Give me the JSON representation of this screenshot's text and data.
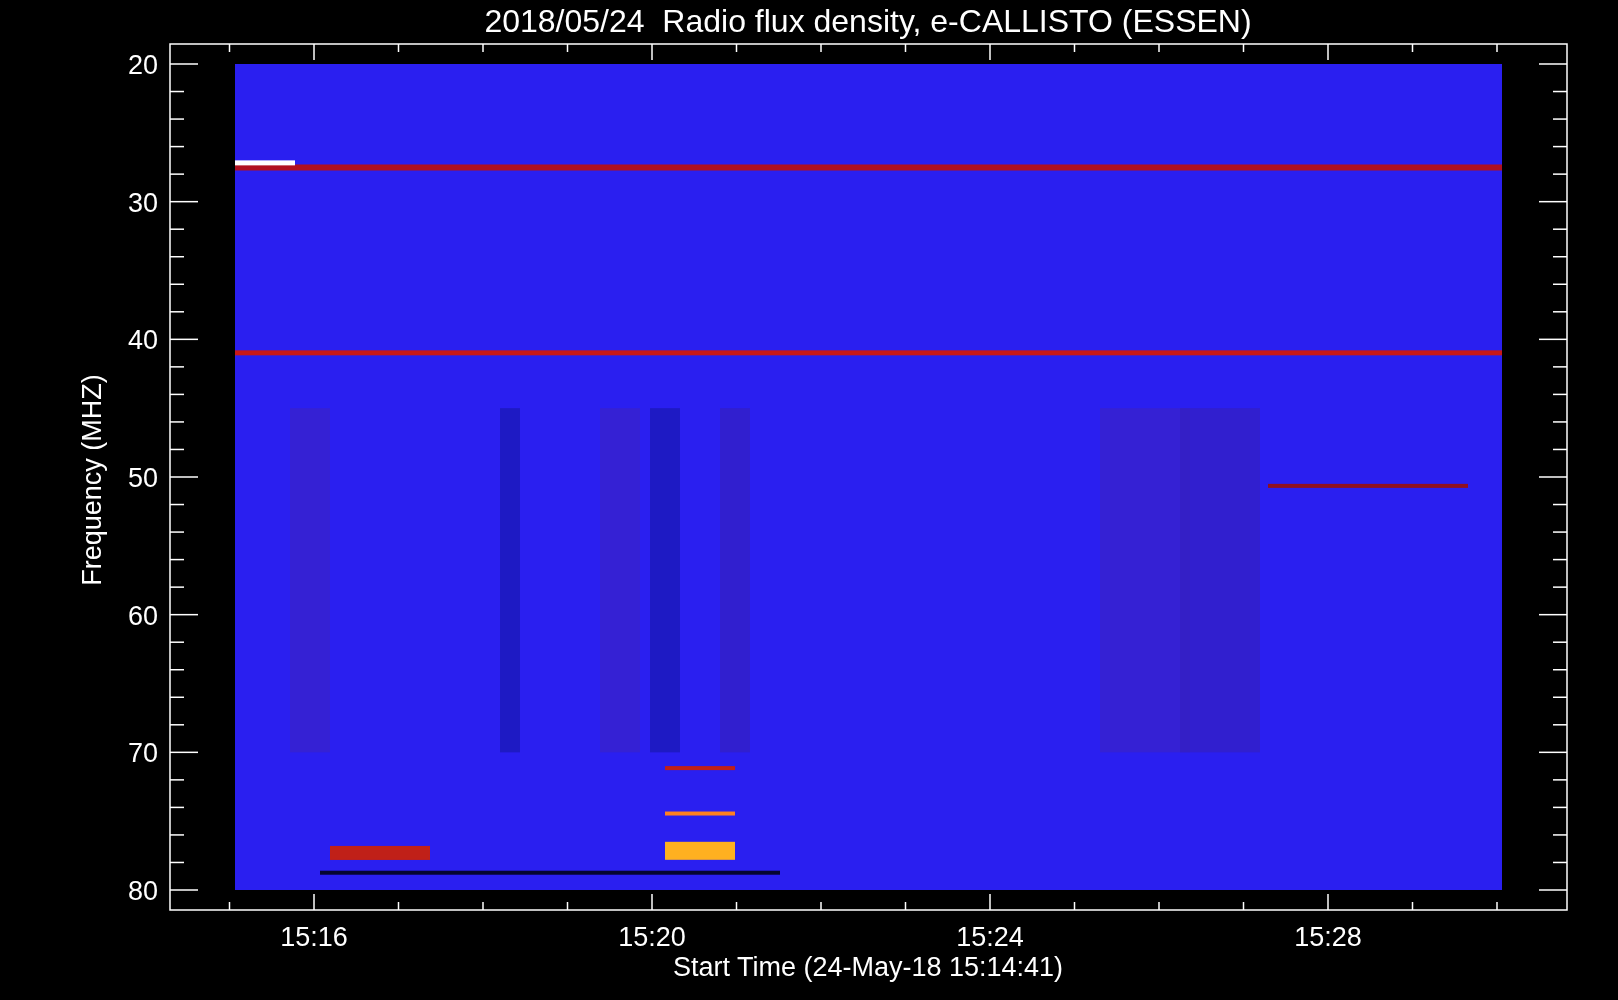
{
  "title": "2018/05/24  Radio flux density, e-CALLISTO (ESSEN)",
  "y_axis": {
    "label": "Frequency (MHZ)",
    "ticks": [
      "20",
      "30",
      "40",
      "50",
      "60",
      "70",
      "80"
    ]
  },
  "x_axis": {
    "label": "Start Time (24-May-18 15:14:41)",
    "ticks": [
      "15:16",
      "15:20",
      "15:24",
      "15:28"
    ]
  }
}
